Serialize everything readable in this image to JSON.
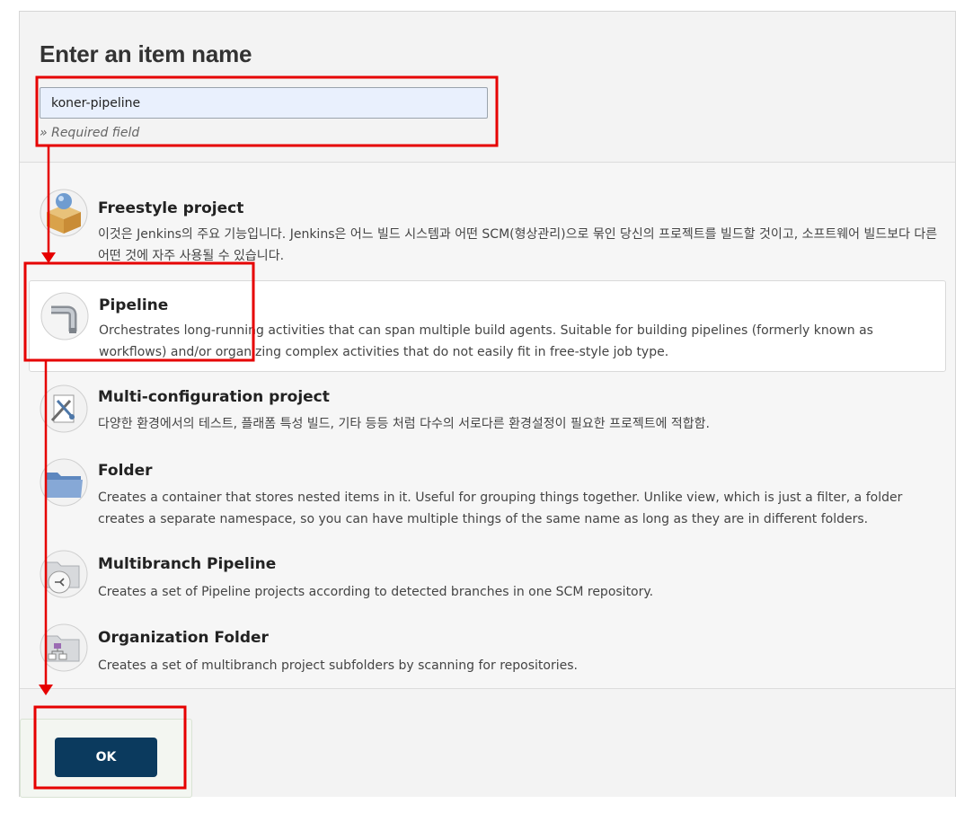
{
  "header": {
    "title": "Enter an item name",
    "input_value": "koner-pipeline",
    "hint": "» Required field"
  },
  "item_types": [
    {
      "title": "Freestyle project",
      "description": "이것은 Jenkins의 주요 기능입니다. Jenkins은 어느 빌드 시스템과 어떤 SCM(형상관리)으로 묶인 당신의 프로젝트를 빌드할 것이고, 소프트웨어 빌드보다 다른 어떤 것에 자주 사용될 수 있습니다.",
      "icon": "freestyle-box-icon"
    },
    {
      "title": "Pipeline",
      "description": "Orchestrates long-running activities that can span multiple build agents. Suitable for building pipelines (formerly known as workflows) and/or organizing complex activities that do not easily fit in free-style job type.",
      "icon": "pipe-icon",
      "selected": true
    },
    {
      "title": "Multi-configuration project",
      "description": "다양한 환경에서의 테스트, 플래폼 특성 빌드, 기타 등등 처럼 다수의 서로다른 환경설정이 필요한 프로젝트에 적합함.",
      "icon": "tools-icon"
    },
    {
      "title": "Folder",
      "description": "Creates a container that stores nested items in it. Useful for grouping things together. Unlike view, which is just a filter, a folder creates a separate namespace, so you can have multiple things of the same name as long as they are in different folders.",
      "icon": "folder-icon"
    },
    {
      "title": "Multibranch Pipeline",
      "description": "Creates a set of Pipeline projects according to detected branches in one SCM repository.",
      "icon": "multibranch-folder-icon"
    },
    {
      "title": "Organization Folder",
      "description": "Creates a set of multibranch project subfolders by scanning for repositories.",
      "icon": "organization-folder-icon"
    }
  ],
  "footer": {
    "ok_label": "OK"
  },
  "colors": {
    "ok_button": "#0b3a5e",
    "annotation": "#e60000",
    "input_bg": "#e9f0fd"
  }
}
